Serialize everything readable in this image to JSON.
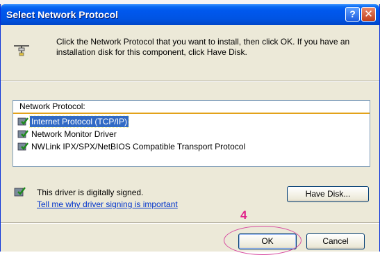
{
  "window": {
    "title": "Select Network Protocol",
    "help_glyph": "?",
    "close_glyph": "✕",
    "header_icon": "network-protocol-icon"
  },
  "instructions": "Click the Network Protocol that you want to install, then click OK. If you have an installation disk for this component, click Have Disk.",
  "list": {
    "header": "Network Protocol:",
    "items": [
      {
        "label": "Internet Protocol (TCP/IP)",
        "icon": "protocol-icon",
        "selected": true
      },
      {
        "label": "Network Monitor Driver",
        "icon": "protocol-icon",
        "selected": false
      },
      {
        "label": "NWLink IPX/SPX/NetBIOS Compatible Transport Protocol",
        "icon": "protocol-icon",
        "selected": false
      }
    ]
  },
  "signing": {
    "status": "This driver is digitally signed.",
    "link": "Tell me why driver signing is important",
    "icon": "signed-driver-icon"
  },
  "buttons": {
    "have_disk": "Have Disk...",
    "ok": "OK",
    "cancel": "Cancel"
  },
  "annotation": {
    "step_number": "4",
    "color": "#e0208a"
  },
  "colors": {
    "titlebar": "#0054e3",
    "selection": "#316ac5",
    "window_bg": "#ece9d8",
    "link": "#0033cc"
  }
}
